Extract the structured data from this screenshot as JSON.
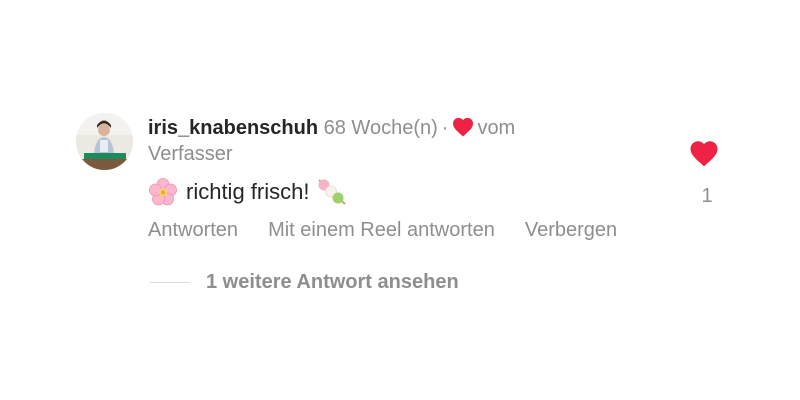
{
  "comment": {
    "username": "iris_knabenschuh",
    "timestamp": "68 Woche(n)",
    "separator": "·",
    "liked_by_author_text": "vom",
    "liked_by_author_text_2": "Verfasser",
    "body": "richtig frisch!",
    "emoji_before": "flower-emoji",
    "emoji_after": "dango-emoji",
    "like_count": "1"
  },
  "actions": {
    "reply": "Antworten",
    "reply_with_reel": "Mit einem Reel antworten",
    "hide": "Verbergen"
  },
  "replies": {
    "view_more": "1 weitere Antwort ansehen"
  },
  "colors": {
    "heart": "#ed4956",
    "primary_text": "#262626",
    "secondary_text": "#8e8e8e"
  }
}
